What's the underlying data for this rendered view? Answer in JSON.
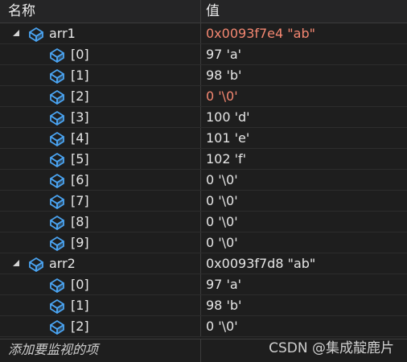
{
  "header": {
    "name_label": "名称",
    "value_label": "值"
  },
  "colors": {
    "background": "#1e1e1e",
    "text": "#e6e6e6",
    "changed_value": "#f48771",
    "icon_blue": "#4aa3f0"
  },
  "rows": [
    {
      "level": 0,
      "expanded": true,
      "icon": "object-icon",
      "name": "arr1",
      "value": "0x0093f7e4 \"ab\"",
      "changed": true
    },
    {
      "level": 1,
      "icon": "object-icon",
      "name": "[0]",
      "value": "97 'a'",
      "changed": false
    },
    {
      "level": 1,
      "icon": "object-icon",
      "name": "[1]",
      "value": "98 'b'",
      "changed": false
    },
    {
      "level": 1,
      "icon": "object-icon",
      "name": "[2]",
      "value": "0 '\\0'",
      "changed": true
    },
    {
      "level": 1,
      "icon": "object-icon",
      "name": "[3]",
      "value": "100 'd'",
      "changed": false
    },
    {
      "level": 1,
      "icon": "object-icon",
      "name": "[4]",
      "value": "101 'e'",
      "changed": false
    },
    {
      "level": 1,
      "icon": "object-icon",
      "name": "[5]",
      "value": "102 'f'",
      "changed": false
    },
    {
      "level": 1,
      "icon": "object-icon",
      "name": "[6]",
      "value": "0 '\\0'",
      "changed": false
    },
    {
      "level": 1,
      "icon": "object-icon",
      "name": "[7]",
      "value": "0 '\\0'",
      "changed": false
    },
    {
      "level": 1,
      "icon": "object-icon",
      "name": "[8]",
      "value": "0 '\\0'",
      "changed": false
    },
    {
      "level": 1,
      "icon": "object-icon",
      "name": "[9]",
      "value": "0 '\\0'",
      "changed": false
    },
    {
      "level": 0,
      "expanded": true,
      "icon": "object-icon",
      "name": "arr2",
      "value": "0x0093f7d8 \"ab\"",
      "changed": false
    },
    {
      "level": 1,
      "icon": "object-icon",
      "name": "[0]",
      "value": "97 'a'",
      "changed": false
    },
    {
      "level": 1,
      "icon": "object-icon",
      "name": "[1]",
      "value": "98 'b'",
      "changed": false
    },
    {
      "level": 1,
      "icon": "object-icon",
      "name": "[2]",
      "value": "0 '\\0'",
      "changed": false
    }
  ],
  "add_watch_label": "添加要监视的项",
  "watermark": "CSDN @集成靛鹿片"
}
